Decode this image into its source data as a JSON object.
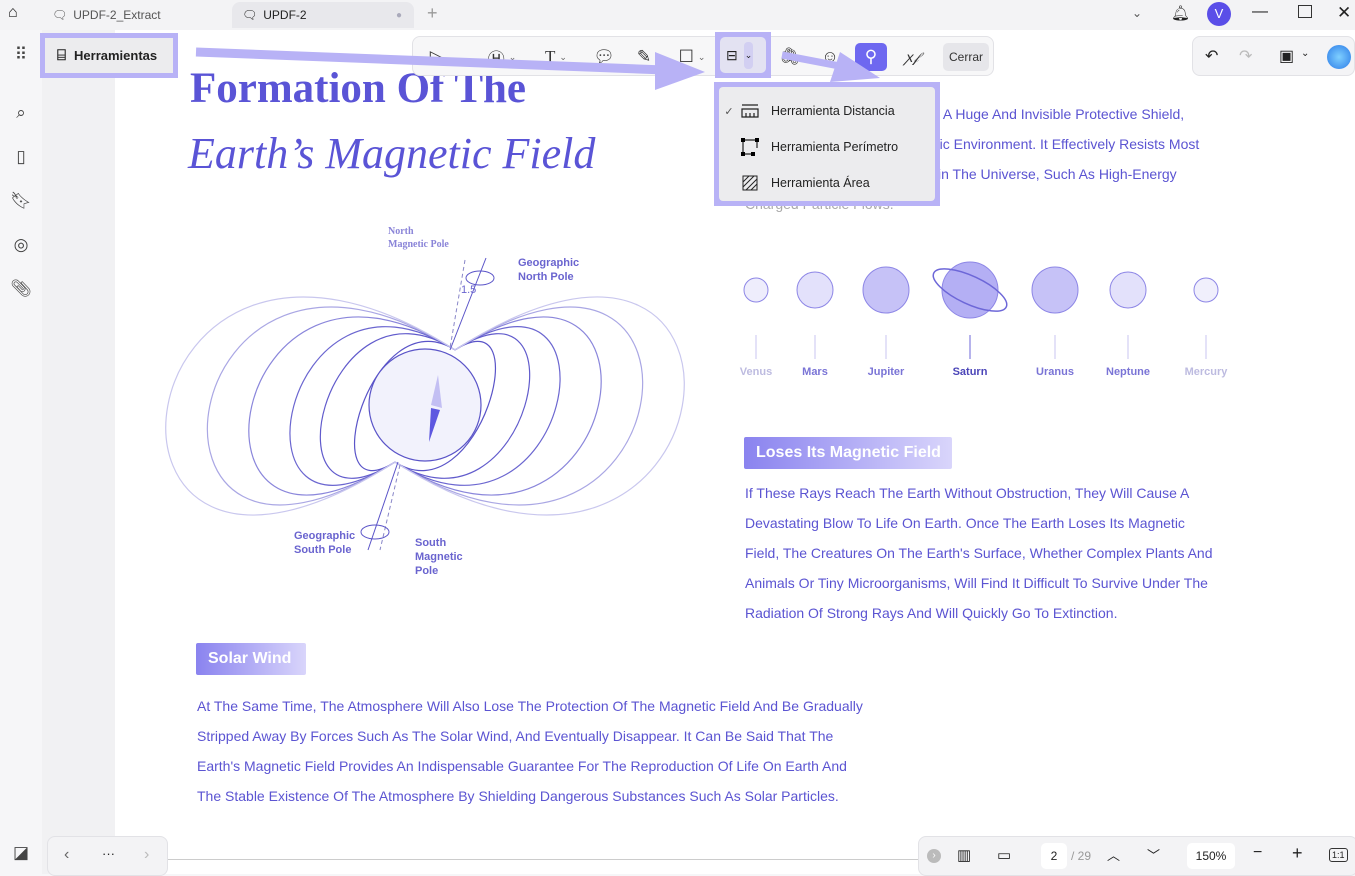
{
  "tabs": [
    {
      "label": "UPDF-2_Extract"
    },
    {
      "label": "UPDF-2"
    }
  ],
  "user_initial": "V",
  "tools_button": "Herramientas",
  "toolbar": {
    "close_label": "Cerrar"
  },
  "measure_menu": {
    "items": [
      {
        "label": "Herramienta Distancia",
        "checked": true
      },
      {
        "label": "Herramienta Perímetro",
        "checked": false
      },
      {
        "label": "Herramienta Área",
        "checked": false
      }
    ]
  },
  "doc": {
    "title_line1": "Formation Of The",
    "title_line2": "Earth’s Magnetic Field",
    "intro_lines": [
      "ke A Huge And Invisible Protective Shield,",
      "mic Environment. It Effectively Resists Most",
      "in The Universe, Such As High-Energy",
      "Charged Particle Flows."
    ],
    "diagram": {
      "north_magnetic": "North\nMagnetic Pole",
      "north_geo": "Geographic\nNorth Pole",
      "angle": "1.5",
      "south_geo": "Geographic\nSouth Pole",
      "south_magnetic": "South\nMagnetic\nPole"
    },
    "planets": [
      "Venus",
      "Mars",
      "Jupiter",
      "Saturn",
      "Uranus",
      "Neptune",
      "Mercury"
    ],
    "section1": {
      "heading": "Loses Its Magnetic Field",
      "lines": [
        "If These Rays Reach The Earth Without Obstruction, They Will Cause A",
        "Devastating Blow To Life On Earth. Once The Earth Loses Its Magnetic",
        "Field, The Creatures On The Earth's Surface, Whether Complex Plants And",
        "Animals Or Tiny Microorganisms, Will Find It Difficult To Survive Under The",
        "Radiation Of Strong Rays And Will Quickly Go To Extinction."
      ]
    },
    "section2": {
      "heading": "Solar Wind",
      "lines": [
        "At The Same Time, The Atmosphere Will Also Lose The Protection Of The Magnetic Field And Be Gradually",
        "Stripped Away By Forces Such As The Solar Wind, And Eventually Disappear. It Can Be Said That The",
        "Earth's Magnetic Field Provides An Indispensable Guarantee For The Reproduction Of Life On Earth And",
        "The Stable Existence Of The Atmosphere By Shielding Dangerous Substances Such As Solar Particles."
      ]
    }
  },
  "bottom": {
    "page_current": "2",
    "page_total": "/ 29",
    "zoom": "150%",
    "more": "···",
    "fit": "1:1"
  },
  "colors": {
    "accent": "#5b54d2",
    "highlight": "#b8b2f6",
    "stamp_active": "#6e68f0"
  }
}
